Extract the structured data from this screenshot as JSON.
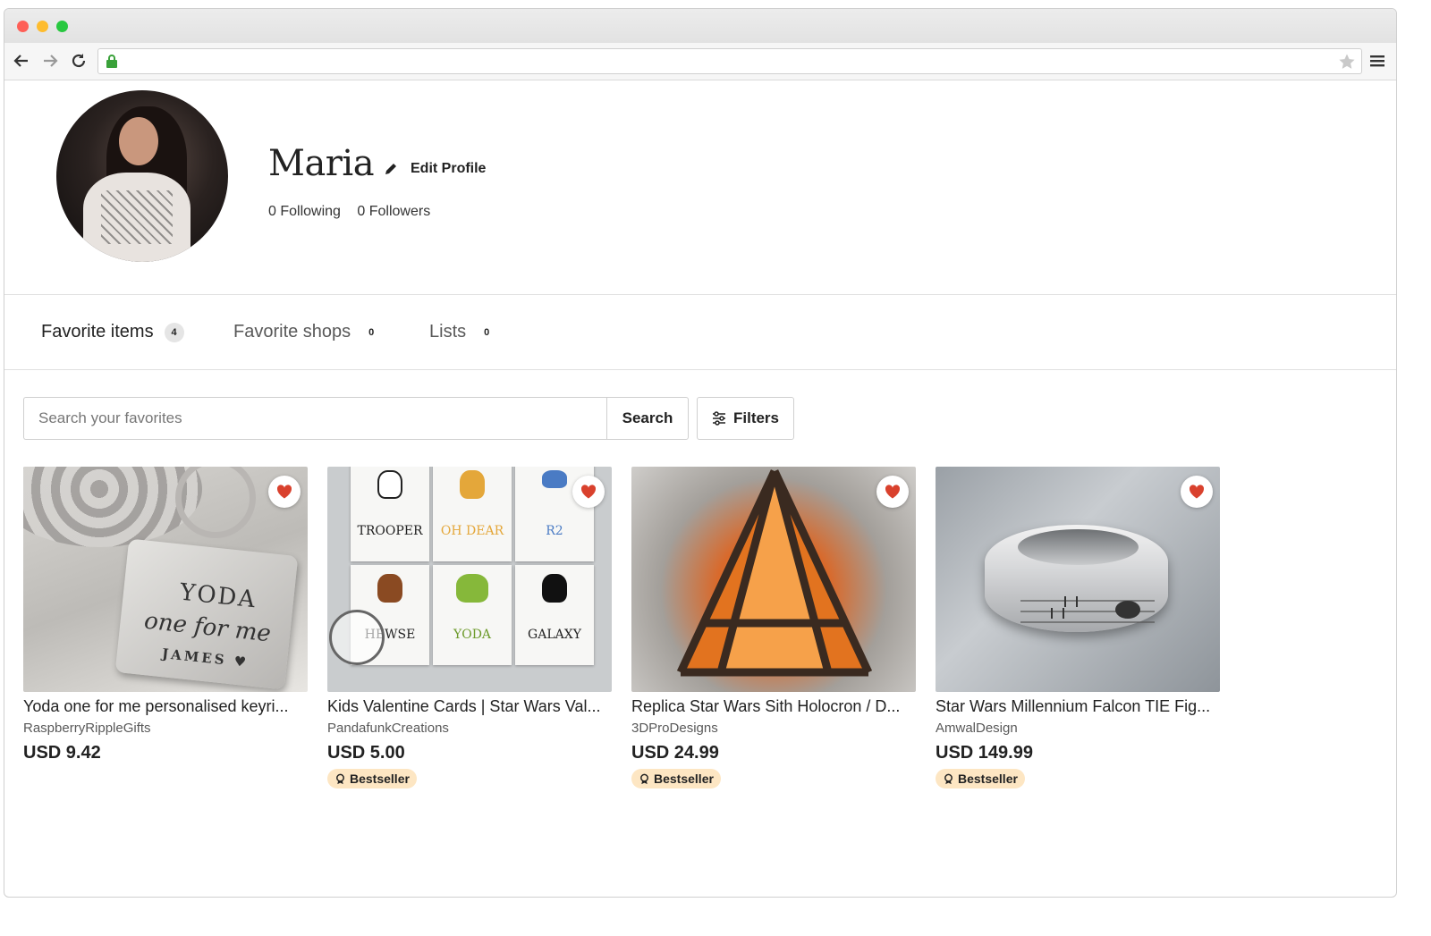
{
  "browser": {
    "url": ""
  },
  "profile": {
    "name": "Maria",
    "edit_label": "Edit Profile",
    "following": "0 Following",
    "followers": "0 Followers"
  },
  "tabs": [
    {
      "label": "Favorite items",
      "count": "4",
      "active": true
    },
    {
      "label": "Favorite shops",
      "count": "0",
      "active": false
    },
    {
      "label": "Lists",
      "count": "0",
      "active": false
    }
  ],
  "search": {
    "placeholder": "Search your favorites",
    "button_label": "Search",
    "filters_label": "Filters"
  },
  "items": [
    {
      "title": "Yoda one for me personalised keyri...",
      "shop": "RaspberryRippleGifts",
      "price": "USD 9.42",
      "badge": ""
    },
    {
      "title": "Kids Valentine Cards | Star Wars Val...",
      "shop": "PandafunkCreations",
      "price": "USD 5.00",
      "badge": "Bestseller"
    },
    {
      "title": "Replica Star Wars Sith Holocron / D...",
      "shop": "3DProDesigns",
      "price": "USD 24.99",
      "badge": "Bestseller"
    },
    {
      "title": "Star Wars Millennium Falcon TIE Fig...",
      "shop": "AmwalDesign",
      "price": "USD 149.99",
      "badge": "Bestseller"
    }
  ],
  "thumb_text": {
    "item1": {
      "line1": "YODA",
      "line2": "one for me",
      "line3": "JAMES ♥"
    },
    "item2": {
      "cards": [
        "TROOPER",
        "OH DEAR",
        "R2",
        "HEWSE",
        "YODA",
        "GALAXY"
      ]
    }
  },
  "colors": {
    "heart": "#d9412d",
    "badge_bg": "#fde6c3"
  }
}
